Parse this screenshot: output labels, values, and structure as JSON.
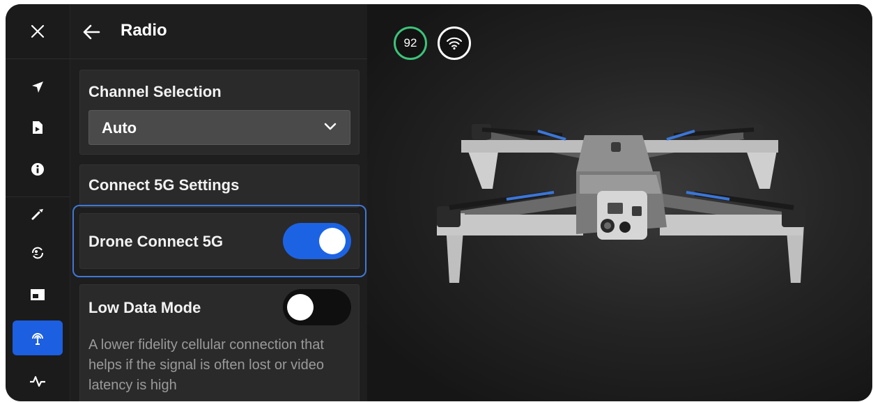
{
  "panel": {
    "title": "Radio"
  },
  "rail": {
    "items": [
      {
        "icon": "navigate-icon"
      },
      {
        "icon": "media-icon"
      },
      {
        "icon": "info-icon"
      },
      {
        "icon": "tool-icon"
      },
      {
        "icon": "sync-icon"
      },
      {
        "icon": "picture-in-picture-icon"
      },
      {
        "icon": "radio-icon",
        "active": true
      },
      {
        "icon": "activity-icon"
      }
    ]
  },
  "channel": {
    "label": "Channel Selection",
    "value": "Auto"
  },
  "connect5g": {
    "label": "Connect 5G Settings"
  },
  "drone_connect": {
    "label": "Drone Connect 5G",
    "enabled": true
  },
  "low_data": {
    "label": "Low Data Mode",
    "enabled": false,
    "description": "A lower fidelity cellular connection that helps if the signal is often lost or video latency is high"
  },
  "status": {
    "battery": "92"
  },
  "colors": {
    "accent": "#1c63e4",
    "battery_ring": "#3dc27a",
    "focus": "#3f78d6"
  }
}
